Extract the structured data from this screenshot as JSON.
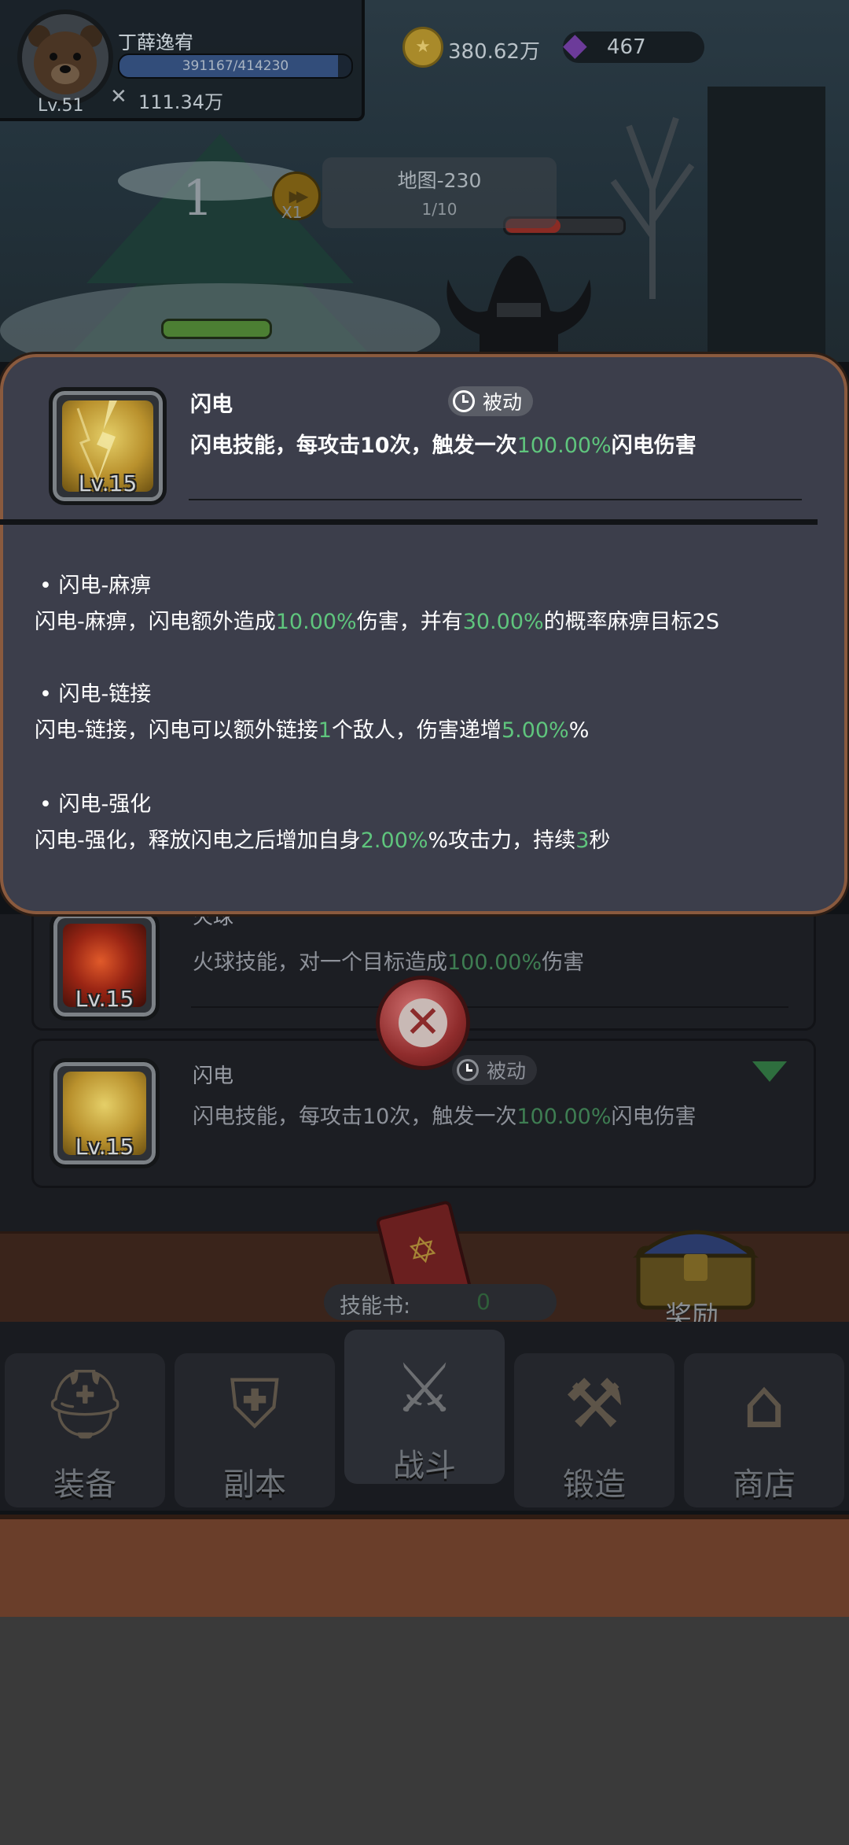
{
  "player": {
    "name": "丁薛逸宥",
    "level": "Lv.51",
    "exp_text": "391167/414230",
    "exp_fraction": 0.944,
    "power": "111.34万"
  },
  "currency": {
    "gold": "380.62万",
    "gems": "467"
  },
  "stage": {
    "number": "1",
    "speed": "X1",
    "map": "地图-230",
    "wave": "1/10"
  },
  "popup": {
    "skill_name": "闪电",
    "passive_tag": "被动",
    "level": "Lv.15",
    "desc_prefix": "闪电技能，每攻击10次，触发一次",
    "desc_value": "100.00%",
    "desc_suffix": "闪电伤害",
    "effects": [
      {
        "title": "• 闪电-麻痹",
        "desc_parts": [
          "闪电-麻痹，闪电额外造成",
          "10.00%",
          "伤害，并有",
          "30.00%",
          "的概率麻痹目标2S"
        ]
      },
      {
        "title": "• 闪电-链接",
        "desc_parts": [
          "闪电-链接，闪电可以额外链接",
          "1",
          "个敌人，伤害递增",
          "5.00%",
          "%"
        ]
      },
      {
        "title": "• 闪电-强化",
        "desc_parts": [
          "闪电-强化，释放闪电之后增加自身",
          "2.00%",
          "%攻击力，持续",
          "3",
          "秒"
        ]
      }
    ],
    "highlight_color": "#5fc57d"
  },
  "skill_list": [
    {
      "name": "火球",
      "level": "Lv.15",
      "desc_prefix": "火球技能，对一个目标造成",
      "desc_value": "100.00%",
      "desc_suffix": "伤害"
    },
    {
      "name": "闪电",
      "passive_tag": "被动",
      "level": "Lv.15",
      "desc_prefix": "闪电技能，每攻击10次，触发一次",
      "desc_value": "100.00%",
      "desc_suffix": "闪电伤害"
    }
  ],
  "skillbook": {
    "label": "技能书:",
    "count": "0"
  },
  "reward_label": "奖励",
  "nav": [
    {
      "label": "装备",
      "icon": "helmet-icon"
    },
    {
      "label": "副本",
      "icon": "sword-shield-icon"
    },
    {
      "label": "战斗",
      "icon": "crossed-swords-icon"
    },
    {
      "label": "锻造",
      "icon": "scroll-hammer-icon"
    },
    {
      "label": "商店",
      "icon": "shop-icon"
    }
  ]
}
